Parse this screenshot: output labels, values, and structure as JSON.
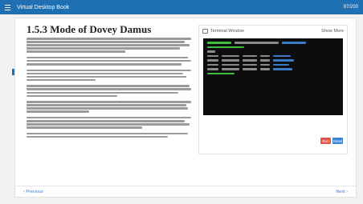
{
  "topbar": {
    "title": "Virtual Desktop Book",
    "page": "97/200"
  },
  "article": {
    "heading": "1.5.3 Mode of Dovey Damus"
  },
  "terminal_panel": {
    "title": "Terminal Window",
    "action": "Show More",
    "run_label": "Run",
    "reset_label": "Reset"
  },
  "footer": {
    "prev": "‹ Previous",
    "next": "Next ›"
  },
  "colors": {
    "accent": "#1f6fb3",
    "link": "#3a7bc8",
    "terminal_bg": "#0d0d0d",
    "terminal_green": "#3fbf3f",
    "run_button": "#e2574c",
    "reset_button": "#3a86d6"
  }
}
